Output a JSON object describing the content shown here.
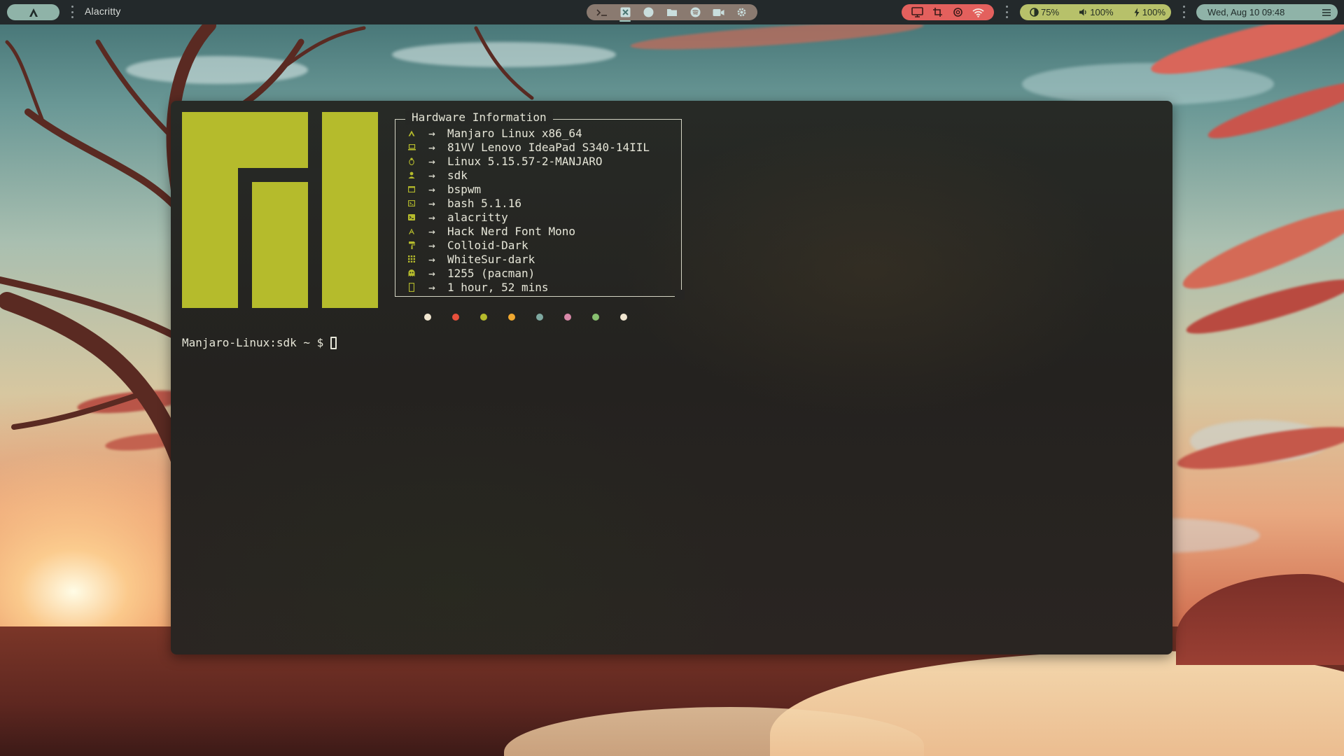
{
  "topbar": {
    "launcher_icon": "manjaro-logo-icon",
    "window_title": "Alacritty",
    "apps": [
      {
        "name": "terminal-app-icon"
      },
      {
        "name": "code-editor-app-icon"
      },
      {
        "name": "firefox-app-icon"
      },
      {
        "name": "files-app-icon"
      },
      {
        "name": "spotify-app-icon"
      },
      {
        "name": "video-app-icon"
      },
      {
        "name": "settings-app-icon"
      }
    ],
    "system_tools": [
      "monitor-icon",
      "crop-icon",
      "record-icon",
      "wifi-icon"
    ],
    "brightness": "75%",
    "volume": "100%",
    "battery": "100%",
    "datetime": "Wed, Aug 10 09:48",
    "menu_icon": "menu-icon",
    "colors": {
      "bar_bg": "#23292b",
      "launcher_pill": "#8fb3a8",
      "apps_pill": "#8a7a70",
      "system_pill": "#e3605d",
      "status_pill": "#b7c16a",
      "date_pill": "#8fb3a8"
    }
  },
  "terminal": {
    "logo_color": "#b5bb2c",
    "info_title": "Hardware Information",
    "arrow": "→",
    "info_rows": [
      {
        "icon": "arch-icon",
        "value": "Manjaro Linux x86_64"
      },
      {
        "icon": "laptop-icon",
        "value": "81VV Lenovo IdeaPad S340-14IIL"
      },
      {
        "icon": "tux-icon",
        "value": "Linux 5.15.57-2-MANJARO"
      },
      {
        "icon": "user-icon",
        "value": "sdk"
      },
      {
        "icon": "window-icon",
        "value": "bspwm"
      },
      {
        "icon": "shell-icon",
        "value": "bash 5.1.16"
      },
      {
        "icon": "terminal-icon",
        "value": "alacritty"
      },
      {
        "icon": "font-icon",
        "value": "Hack Nerd Font Mono"
      },
      {
        "icon": "paint-roller-icon",
        "value": "Colloid-Dark"
      },
      {
        "icon": "icons-grid-icon",
        "value": "WhiteSur-dark"
      },
      {
        "icon": "ghost-icon",
        "value": "1255 (pacman)"
      },
      {
        "icon": "uptime-icon",
        "value": "1 hour, 52 mins"
      }
    ],
    "palette": [
      "#f0e6d0",
      "#e8503c",
      "#b5bb2c",
      "#f0a830",
      "#7ea8a0",
      "#d888a8",
      "#88c070",
      "#f0e6d0"
    ],
    "prompt": "Manjaro-Linux:sdk ~ $"
  }
}
